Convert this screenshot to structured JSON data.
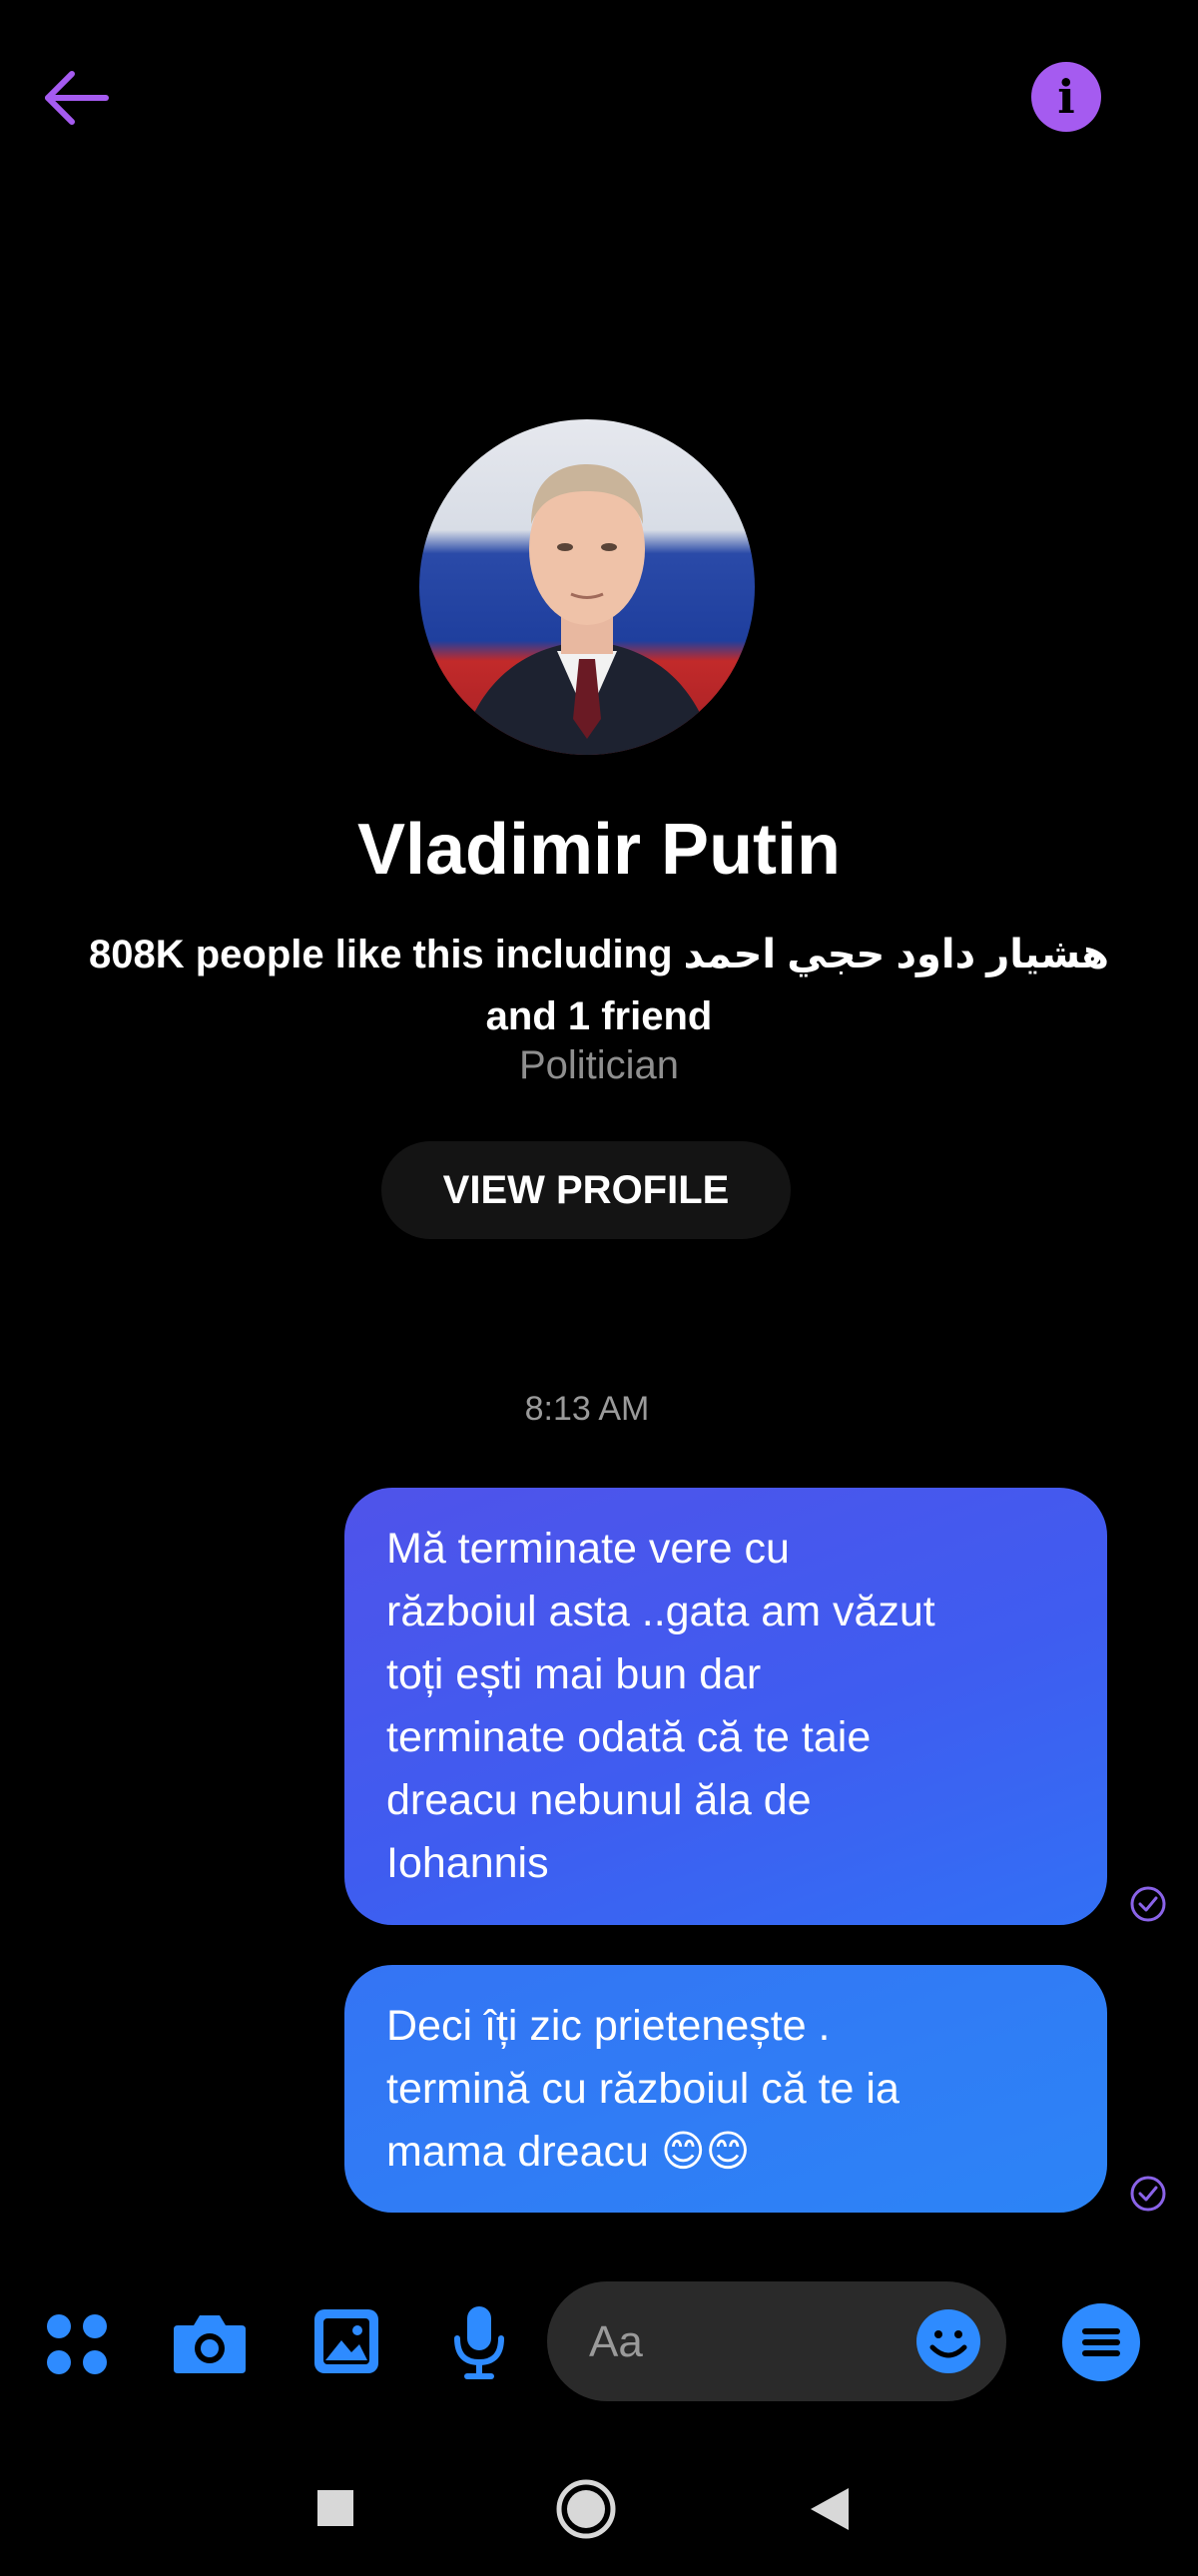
{
  "header": {
    "back_icon": "arrow-left-icon",
    "info_icon": "info-icon",
    "info_symbol": "i",
    "accent_color": "#a55bf0"
  },
  "profile": {
    "name": "Vladimir Putin",
    "likes_line1": "808K people like this including هشيار داود حجي احمد",
    "likes_line2": "and 1 friend",
    "category": "Politician",
    "view_profile_label": "VIEW PROFILE"
  },
  "conversation": {
    "timestamp": "8:13 AM",
    "messages": [
      {
        "lines": [
          "Mă terminate vere cu",
          "războiul asta ..gata am văzut",
          "toți ești mai bun dar",
          "terminate odată că te taie",
          "dreacu nebunul ăla de",
          "Iohannis"
        ],
        "status_icon": "seen-check-icon"
      },
      {
        "lines": [
          "Deci îți zic prietenește .",
          "termină cu războiul că te ia",
          "mama dreacu 😊😊"
        ],
        "status_icon": "seen-check-icon"
      }
    ]
  },
  "composer": {
    "placeholder": "Aa",
    "icons": [
      "apps-icon",
      "camera-icon",
      "gallery-icon",
      "microphone-icon",
      "emoji-icon",
      "menu-icon"
    ],
    "icon_color": "#2e8bff"
  },
  "navbar": {
    "icons": [
      "recents-square-icon",
      "home-circle-icon",
      "back-triangle-icon"
    ]
  }
}
